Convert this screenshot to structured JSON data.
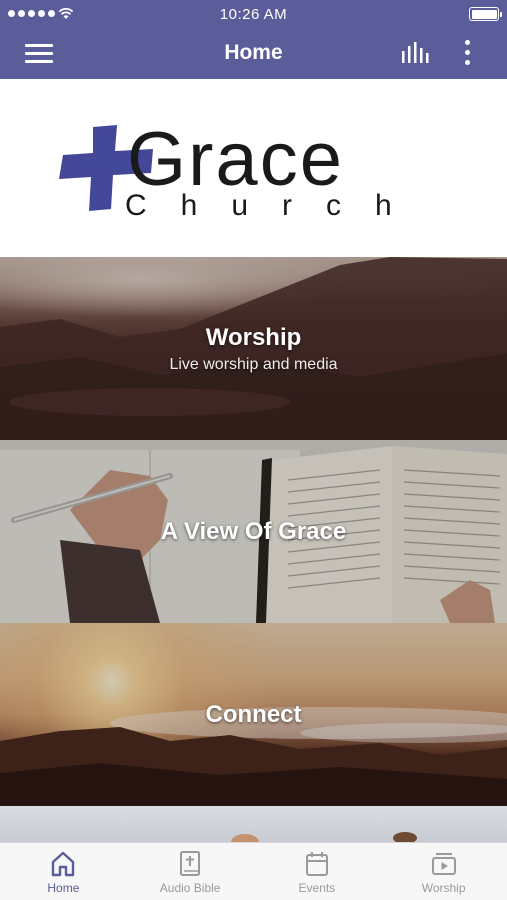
{
  "status_bar": {
    "time": "10:26 AM"
  },
  "nav": {
    "title": "Home",
    "left_icon": "hamburger-menu-icon",
    "right_icons": [
      "equalizer-icon",
      "more-vertical-icon"
    ]
  },
  "logo": {
    "word1": "Grace",
    "word2": "Church"
  },
  "tiles": [
    {
      "title": "Worship",
      "subtitle": "Live worship and media"
    },
    {
      "title": "A View Of Grace",
      "subtitle": ""
    },
    {
      "title": "Connect",
      "subtitle": ""
    }
  ],
  "tab_bar": {
    "items": [
      {
        "label": "Home",
        "icon": "home-icon",
        "active": true
      },
      {
        "label": "Audio Bible",
        "icon": "bible-icon",
        "active": false
      },
      {
        "label": "Events",
        "icon": "calendar-icon",
        "active": false
      },
      {
        "label": "Worship",
        "icon": "video-play-icon",
        "active": false
      }
    ]
  },
  "colors": {
    "brand": "#5a5d9a",
    "logo_cross": "#3a3d8f",
    "tab_active": "#5a5d9a",
    "tab_inactive": "#9a9a9a"
  }
}
